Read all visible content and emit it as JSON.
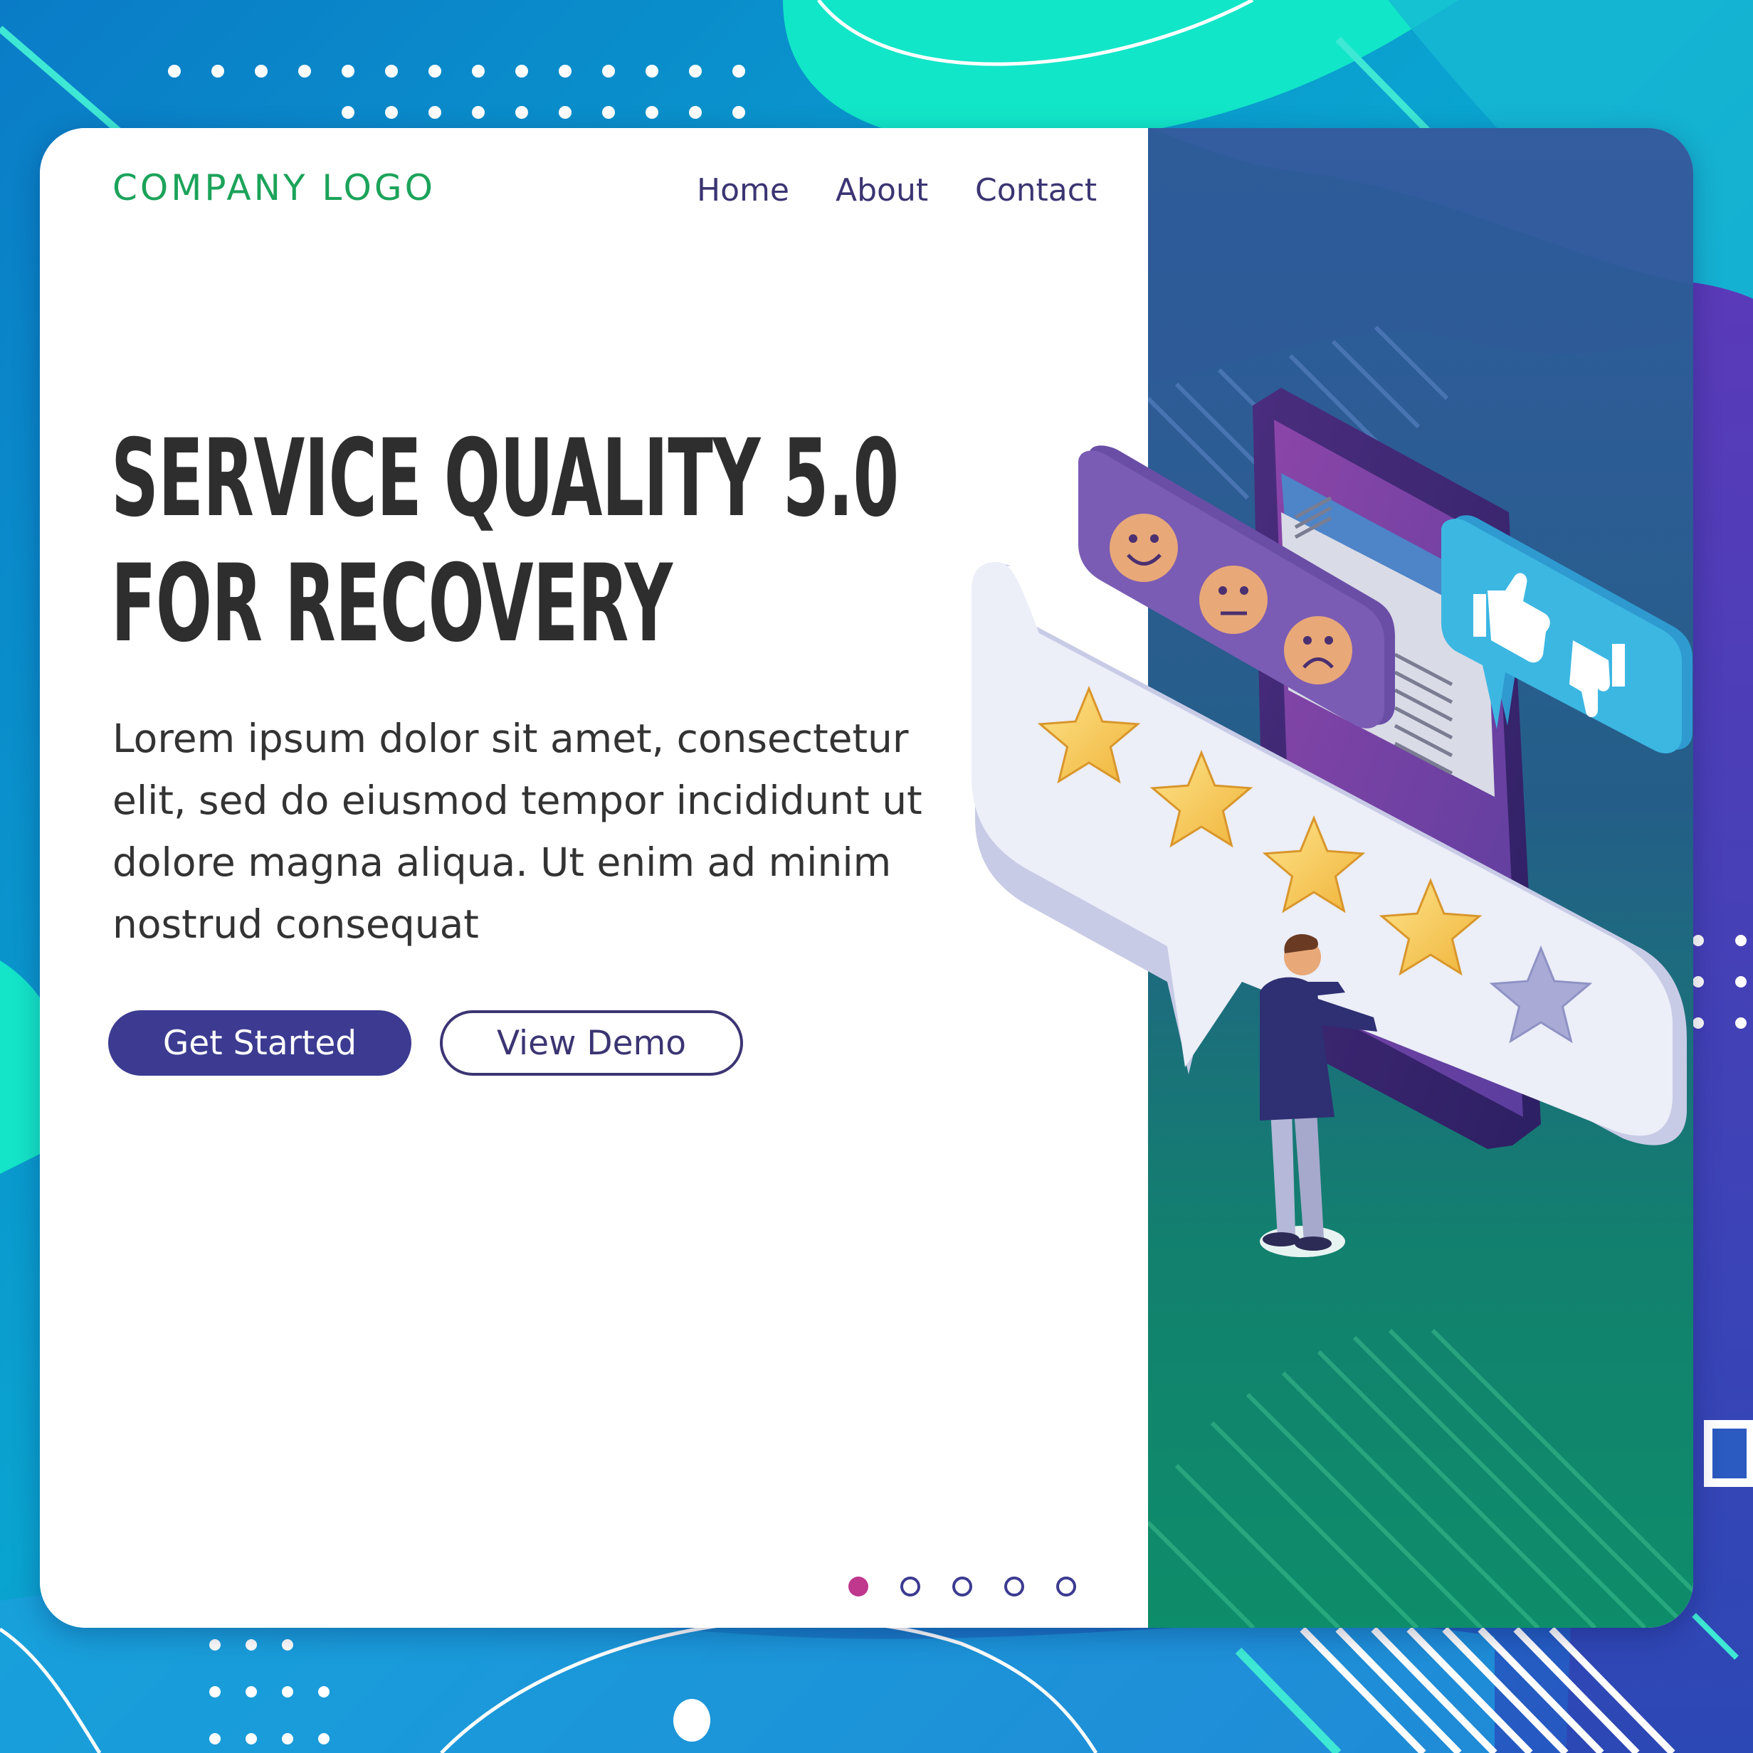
{
  "header": {
    "logo": "COMPANY LOGO",
    "nav": [
      "Home",
      "About",
      "Contact"
    ]
  },
  "hero": {
    "headline_line1": "SERVICE QUALITY 5.0",
    "headline_line2": "FOR RECOVERY",
    "body": "Lorem ipsum dolor sit amet, consectetur elit, sed do eiusmod tempor incididunt ut dolore magna aliqua. Ut enim ad minim nostrud consequat",
    "primary_button": "Get Started",
    "secondary_button": "View Demo"
  },
  "carousel": {
    "slide_count": 5,
    "active_index": 0
  },
  "illustration": {
    "rating": 4,
    "rating_max": 5,
    "icons": [
      "smiley-face-icon",
      "neutral-face-icon",
      "sad-face-icon",
      "thumbs-up-icon",
      "thumbs-down-icon",
      "star-icon",
      "phone-icon",
      "person-figure"
    ]
  },
  "colors": {
    "accent": "#3c3b91",
    "logo": "#1ba35a",
    "active_dot": "#c0378e",
    "star_gold": "#f5c84a",
    "star_empty": "#a9abd6"
  }
}
